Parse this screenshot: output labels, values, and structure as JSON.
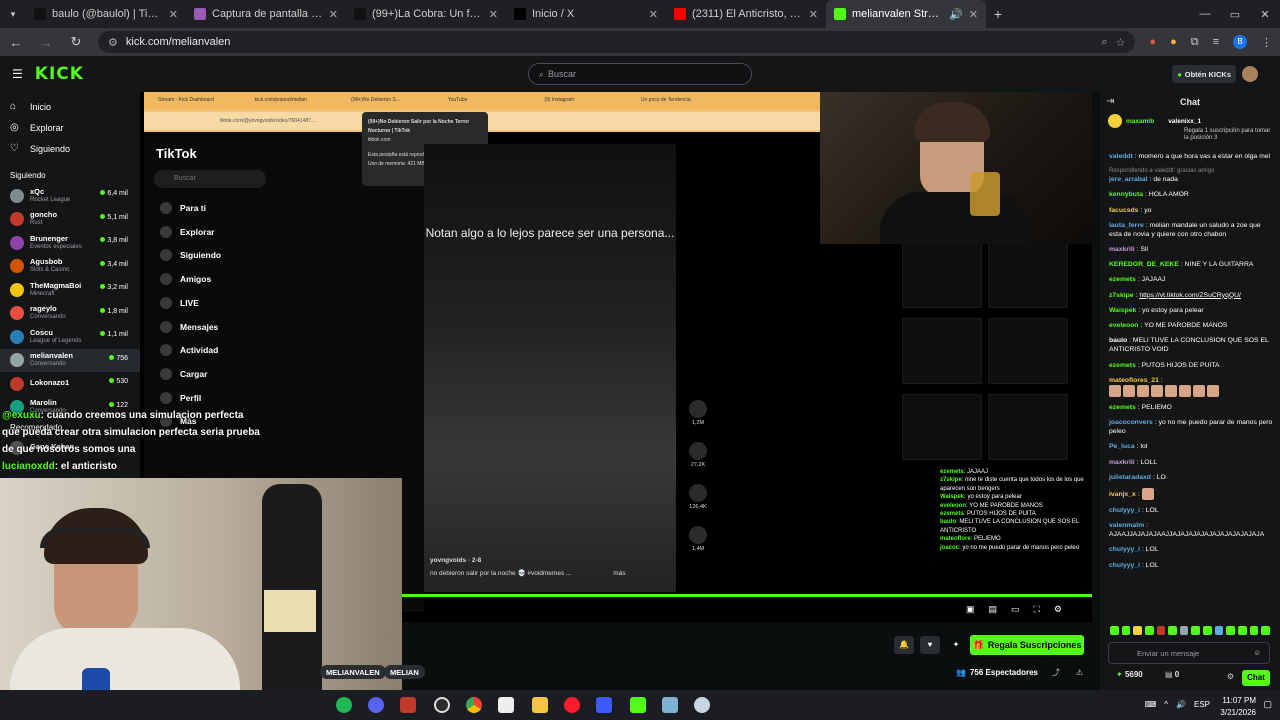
{
  "browser": {
    "tabs": [
      {
        "title": "baulo (@baulol) | TikTok",
        "color": "#111111"
      },
      {
        "title": "Captura de pantalla por Lightshot",
        "color": "#9b59b6"
      },
      {
        "title": "(99+)La Cobra: Un fenómeno en...",
        "color": "#111111"
      },
      {
        "title": "Inicio / X",
        "color": "#000000"
      },
      {
        "title": "(2311) El Anticristo, en una línea...",
        "color": "#ff0000"
      },
      {
        "title": "melianvalen Stream - Watch...",
        "color": "#53fc18",
        "active": true
      }
    ],
    "new_tab": "+",
    "url": "kick.com/melianvalen"
  },
  "kick": {
    "logo": "KICK",
    "search_placeholder": "Buscar",
    "kicks_button": "Obtén KICKs"
  },
  "sidebar": {
    "nav": [
      {
        "label": "Inicio",
        "icon": "home-icon"
      },
      {
        "label": "Explorar",
        "icon": "compass-icon"
      },
      {
        "label": "Siguiendo",
        "icon": "heart-icon"
      }
    ],
    "following_title": "Siguiendo",
    "following": [
      {
        "name": "xQc",
        "sub": "Rocket League",
        "count": "6,4 mil",
        "color": "#7f8c8d"
      },
      {
        "name": "goncho",
        "sub": "Rust",
        "count": "5,1 mil",
        "color": "#c0392b"
      },
      {
        "name": "Brunenger",
        "sub": "Eventos especiales",
        "count": "3,8 mil",
        "color": "#8e44ad"
      },
      {
        "name": "Agusbob",
        "sub": "Slots & Casino",
        "count": "3,4 mil",
        "color": "#d35400"
      },
      {
        "name": "TheMagmaBoi",
        "sub": "Minecraft",
        "count": "3,2 mil",
        "color": "#f1c40f"
      },
      {
        "name": "rageylo",
        "sub": "Conversando",
        "count": "1,8 mil",
        "color": "#e74c3c"
      },
      {
        "name": "Coscu",
        "sub": "League of Legends",
        "count": "1,1 mil",
        "color": "#2980b9"
      },
      {
        "name": "melianvalen",
        "sub": "Conversando",
        "count": "756",
        "color": "#95a5a6"
      },
      {
        "name": "Lokonazo1",
        "sub": "",
        "count": "530",
        "color": "#c0392b"
      },
      {
        "name": "Marolin",
        "sub": "Conversando",
        "count": "122",
        "color": "#16a085"
      }
    ],
    "recommended_title": "Recomendado",
    "recommended": [
      {
        "name": "Gapo Kahan",
        "sub": "",
        "count": ""
      }
    ]
  },
  "stream": {
    "inner_tabs": [
      "Stream - Kick Dashboard",
      "kick.com/popout/melian",
      "(99+)No Debieron S...",
      "YouTube",
      "(9) Instagram",
      "Un poco de Tendencia",
      ""
    ],
    "inner_url": "tiktok.com/@yovngvoids/video/76041487...",
    "tooltip_title": "(99+)No Debieron Salir por la Noche Terror Nocturno | TikTok",
    "tooltip_domain": "tiktok.com",
    "tooltip_audio": "Esta pestaña está reproduciendo audio",
    "tooltip_mem": "Uso de memoria: 421 MB",
    "tiktok": {
      "logo": "TikTok",
      "search": "Buscar",
      "nav": [
        "Para ti",
        "Explorar",
        "Siguiendo",
        "Amigos",
        "LIVE",
        "Mensajes",
        "Actividad",
        "Cargar",
        "Perfil",
        "Más"
      ]
    },
    "video_caption": "Notan algo a lo lejos parece ser una persona...",
    "video_author": "yovngvoids · 2-8",
    "video_desc": "no debieron salir por la noche 💀 #voidmemes ...",
    "video_more": "más",
    "rail": [
      "1,2M",
      "27,2K",
      "126,4K",
      "1,4M"
    ],
    "overlay_left": [
      {
        "user": "@exuxu",
        "text": ": cuando creemos una simulacion perfecta que pueda crear otra simulacion perfecta seria prueba de que nosotros somos una"
      },
      {
        "user": "lucianoxdd",
        "text": ": el anticristo"
      }
    ],
    "overlay_right": [
      {
        "user": "ezemets",
        "text": ": JAJAAJ"
      },
      {
        "user": "z7skipe",
        "text": ": nine te diste cuenta que todos los de los que aparecen son bengers"
      },
      {
        "user": "Waispek",
        "text": ": yo estoy para pelear"
      },
      {
        "user": "eveleoon",
        "text": ": YO ME PAROBDE MANOS"
      },
      {
        "user": "ezemets",
        "text": ": PUTOS HIJOS DE PUITA"
      },
      {
        "user": "baulo",
        "text": ": MELI TUVE LA CONCLUSION QUE SOS EL ANTICRISTO"
      },
      {
        "user": "mateoflore",
        "text": ": PELIEMO"
      },
      {
        "user": "joacoc",
        "text": ": yo no me puedo parar de manos pero peleo"
      }
    ]
  },
  "below": {
    "tags": [
      "MELIANVALEN",
      "MELIAN"
    ],
    "subs_button": "Regala Suscripciones",
    "viewers": "756 Espectadores"
  },
  "chat": {
    "title": "Chat",
    "pinned_user": "valenixx_1",
    "pinned_badge_user": "maxamib",
    "pinned_text": "Regala 1 suscripción para tomar la posición 3",
    "messages": [
      {
        "user": "valeddt",
        "color": "#5dade2",
        "text": "momero a que hora vas a estar en olga mel"
      },
      {
        "user": "jere_arrabal",
        "color": "#5dade2",
        "text": "de nada",
        "reply": "Respondiendo a valeddt: gracias amigo"
      },
      {
        "user": "kennybuta",
        "color": "#53fc18",
        "text": "HOLA AMOR"
      },
      {
        "user": "facucsds",
        "color": "#f4d03f",
        "text": "yo"
      },
      {
        "user": "lauta_ferre",
        "color": "#5dade2",
        "text": "melian mandale un saludo a zoe que esta de novia y quiere con otro chabon"
      },
      {
        "user": "maxkrili",
        "color": "#c39bd3",
        "text": "Sll"
      },
      {
        "user": "KEREDOR_DE_KEKE",
        "color": "#53fc18",
        "text": "NINE Y LA GUITARRA"
      },
      {
        "user": "ezemets",
        "color": "#53fc18",
        "text": "JAJAAJ"
      },
      {
        "user": "z7skipe",
        "color": "#53fc18",
        "text": "https://vt.tiktok.com/ZSuCRyqQU/"
      },
      {
        "user": "Waispek",
        "color": "#53fc18",
        "text": "yo estoy para pelear"
      },
      {
        "user": "eveleoon",
        "color": "#53fc18",
        "text": "YO ME PAROBDE MANOS"
      },
      {
        "user": "baulo",
        "color": "#ffffff",
        "text": "MELI TUVE LA CONCLUSION QUE SOS EL ANTICRISTO VOID"
      },
      {
        "user": "ezemets",
        "color": "#53fc18",
        "text": "PUTOS HIJOS DE PUITA"
      },
      {
        "user": "mateoflores_21",
        "color": "#f4d03f",
        "text": ""
      },
      {
        "user": "ezemets",
        "color": "#53fc18",
        "text": "PELIEMO"
      },
      {
        "user": "joacoconvers",
        "color": "#5dade2",
        "text": "yo no me puedo parar de manos pero peleo"
      },
      {
        "user": "Pe_luca",
        "color": "#5dade2",
        "text": "lol"
      },
      {
        "user": "maxkrili",
        "color": "#c39bd3",
        "text": "LOLL"
      },
      {
        "user": "julietaradaxd",
        "color": "#5dade2",
        "text": "LO"
      },
      {
        "user": "ivanjx_x",
        "color": "#f4d03f",
        "text": ""
      },
      {
        "user": "chulyyy_i",
        "color": "#5dade2",
        "text": "LOL"
      },
      {
        "user": "valenmalm",
        "color": "#5dade2",
        "text": "AJAAJJAJAJAJAAJJAJAJAJAJAJAJAJAJAJAJAJA"
      },
      {
        "user": "chulyyy_i",
        "color": "#5dade2",
        "text": "LOL"
      },
      {
        "user": "chulyyy_i",
        "color": "#5dade2",
        "text": "LOL"
      }
    ],
    "input_placeholder": "Enviar un mensaje",
    "kicks_count": "5690",
    "points": "0",
    "send_label": "Chat"
  },
  "taskbar": {
    "lang": "ESP",
    "time": "11:07 PM",
    "date": "3/21/2026"
  }
}
